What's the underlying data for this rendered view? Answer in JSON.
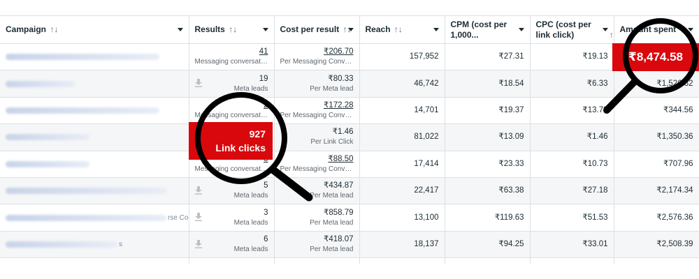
{
  "columns": [
    {
      "key": "campaign",
      "label": "Campaign",
      "sort": "↑↓"
    },
    {
      "key": "results",
      "label": "Results",
      "sort": "↑↓"
    },
    {
      "key": "cost_per_result",
      "label": "Cost per result",
      "sort": "↑↓"
    },
    {
      "key": "reach",
      "label": "Reach",
      "sort": "↑↓"
    },
    {
      "key": "cpm",
      "label": "CPM (cost per 1,000...",
      "sort": ""
    },
    {
      "key": "cpc",
      "label": "CPC (cost per link click)",
      "sort": "↑↓"
    },
    {
      "key": "amount_spent",
      "label": "Amount spent",
      "sort": "↑↓"
    }
  ],
  "rows": [
    {
      "results": "41",
      "results_sub": "Messaging conversati...",
      "cpr": "₹206.70",
      "cpr_sub": "Per Messaging Conve...",
      "reach": "157,952",
      "cpm": "₹27.31",
      "cpc": "₹19.13",
      "spent": "₹8,474.58"
    },
    {
      "results": "19",
      "results_sub": "Meta leads",
      "cpr": "₹80.33",
      "cpr_sub": "Per Meta lead",
      "reach": "46,742",
      "cpm": "₹18.54",
      "cpc": "₹6.33",
      "spent": "₹1,526.32"
    },
    {
      "results": "2",
      "results_sub": "Messaging conversati...",
      "cpr": "₹172.28",
      "cpr_sub": "Per Messaging Conve...",
      "reach": "14,701",
      "cpm": "₹19.37",
      "cpc": "₹13.78",
      "spent": "₹344.56"
    },
    {
      "results": "927",
      "results_sub": "Link clicks",
      "cpr": "₹1.46",
      "cpr_sub": "Per Link Click",
      "reach": "81,022",
      "cpm": "₹13.09",
      "cpc": "₹1.46",
      "spent": "₹1,350.36"
    },
    {
      "results": "8",
      "results_sub": "Messaging conversati...",
      "cpr": "₹88.50",
      "cpr_sub": "Per Messaging Conve...",
      "reach": "17,414",
      "cpm": "₹23.33",
      "cpc": "₹10.73",
      "spent": "₹707.96"
    },
    {
      "results": "5",
      "results_sub": "Meta leads",
      "cpr": "₹434.87",
      "cpr_sub": "Per Meta lead",
      "reach": "22,417",
      "cpm": "₹63.38",
      "cpc": "₹27.18",
      "spent": "₹2,174.34"
    },
    {
      "results": "3",
      "results_sub": "Meta leads",
      "cpr": "₹858.79",
      "cpr_sub": "Per Meta lead",
      "reach": "13,100",
      "cpm": "₹119.63",
      "cpc": "₹51.53",
      "spent": "₹2,576.36"
    },
    {
      "results": "6",
      "results_sub": "Meta leads",
      "cpr": "₹418.07",
      "cpr_sub": "Per Meta lead",
      "reach": "18,137",
      "cpm": "₹94.25",
      "cpc": "₹33.01",
      "spent": "₹2,508.39"
    }
  ],
  "campaign_fragments": [
    "",
    "",
    "",
    "",
    "",
    "",
    "rse Cou",
    "s"
  ],
  "highlights": {
    "amount_spent": "₹8,474.58",
    "link_clicks_value": "927",
    "link_clicks_label": "Link clicks"
  },
  "colors": {
    "highlight": "#d9080c",
    "magnifier": "#000000"
  },
  "icons": {
    "download": "download-icon",
    "dropdown": "caret-down-icon",
    "magnifier": "magnifier-icon"
  }
}
